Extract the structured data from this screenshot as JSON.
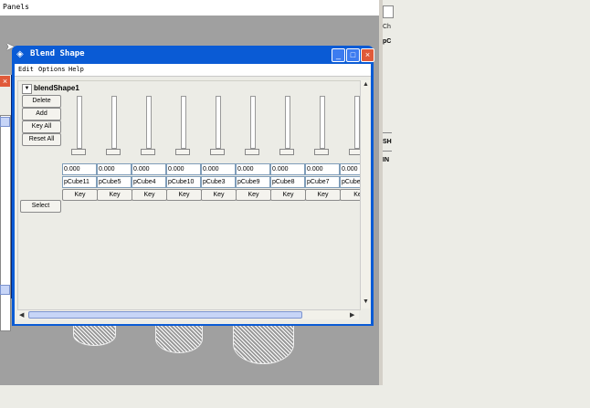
{
  "app": {
    "menubar_label": "Panels"
  },
  "window": {
    "title": "Blend Shape",
    "menu": [
      "Edit",
      "Options",
      "Help"
    ]
  },
  "node": {
    "name": "blendShape1"
  },
  "buttons": {
    "delete": "Delete",
    "add": "Add",
    "key_all": "Key All",
    "reset_all": "Reset All",
    "select": "Select"
  },
  "targets": [
    {
      "value": "0.000",
      "name": "pCube11",
      "key": "Key",
      "level": 0
    },
    {
      "value": "0.000",
      "name": "pCube5",
      "key": "Key",
      "level": 0
    },
    {
      "value": "0.000",
      "name": "pCube4",
      "key": "Key",
      "level": 0
    },
    {
      "value": "0.000",
      "name": "pCube10",
      "key": "Key",
      "level": 0
    },
    {
      "value": "0.000",
      "name": "pCube3",
      "key": "Key",
      "level": 0
    },
    {
      "value": "0.000",
      "name": "pCube9",
      "key": "Key",
      "level": 0
    },
    {
      "value": "0.000",
      "name": "pCube8",
      "key": "Key",
      "level": 0
    },
    {
      "value": "0.000",
      "name": "pCube7",
      "key": "Key",
      "level": 0
    },
    {
      "value": "0.000",
      "name": "pCube",
      "key": "Ke",
      "level": 0
    }
  ],
  "right_panel": {
    "label_a": "Ch",
    "label_b": "pC",
    "label_c": "SH",
    "label_d": "IN"
  },
  "icons": {
    "minimize": "minimize-icon",
    "maximize": "maximize-icon",
    "close": "close-icon",
    "app": "maya-icon"
  }
}
